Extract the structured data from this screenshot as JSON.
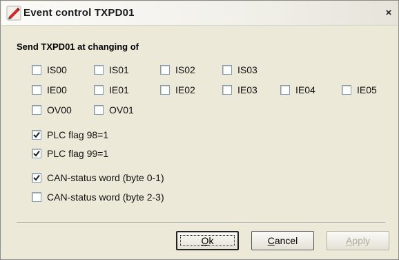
{
  "window": {
    "title": "Event control TXPD01",
    "close_label": "×"
  },
  "section": {
    "label": "Send TXPD01 at changing of"
  },
  "rows": {
    "is": [
      {
        "label": "IS00",
        "checked": false
      },
      {
        "label": "IS01",
        "checked": false
      },
      {
        "label": "IS02",
        "checked": false
      },
      {
        "label": "IS03",
        "checked": false
      }
    ],
    "ie": [
      {
        "label": "IE00",
        "checked": false
      },
      {
        "label": "IE01",
        "checked": false
      },
      {
        "label": "IE02",
        "checked": false
      },
      {
        "label": "IE03",
        "checked": false
      },
      {
        "label": "IE04",
        "checked": false
      },
      {
        "label": "IE05",
        "checked": false
      }
    ],
    "ov": [
      {
        "label": "OV00",
        "checked": false
      },
      {
        "label": "OV01",
        "checked": false
      }
    ]
  },
  "flags": [
    {
      "label": "PLC flag 98=1",
      "checked": true
    },
    {
      "label": "PLC flag 99=1",
      "checked": true
    }
  ],
  "can": [
    {
      "label": "CAN-status word (byte 0-1)",
      "checked": true
    },
    {
      "label": "CAN-status word (byte 2-3)",
      "checked": false
    }
  ],
  "buttons": {
    "ok": {
      "hotkey": "O",
      "rest": "k"
    },
    "cancel": {
      "hotkey": "C",
      "rest": "ancel"
    },
    "apply": {
      "hotkey": "A",
      "rest": "pply",
      "disabled": true
    }
  },
  "colors": {
    "titlebar_text": "#1a1a1a",
    "dialog_bg": "#ece9d8",
    "checkbox_border": "#7f9db9",
    "checkmark": "#1a1a1a",
    "disabled_text": "#b0ae9f"
  },
  "icons": {
    "app": "red-pen-app-icon",
    "close": "close-icon",
    "check": "checkmark-icon"
  }
}
